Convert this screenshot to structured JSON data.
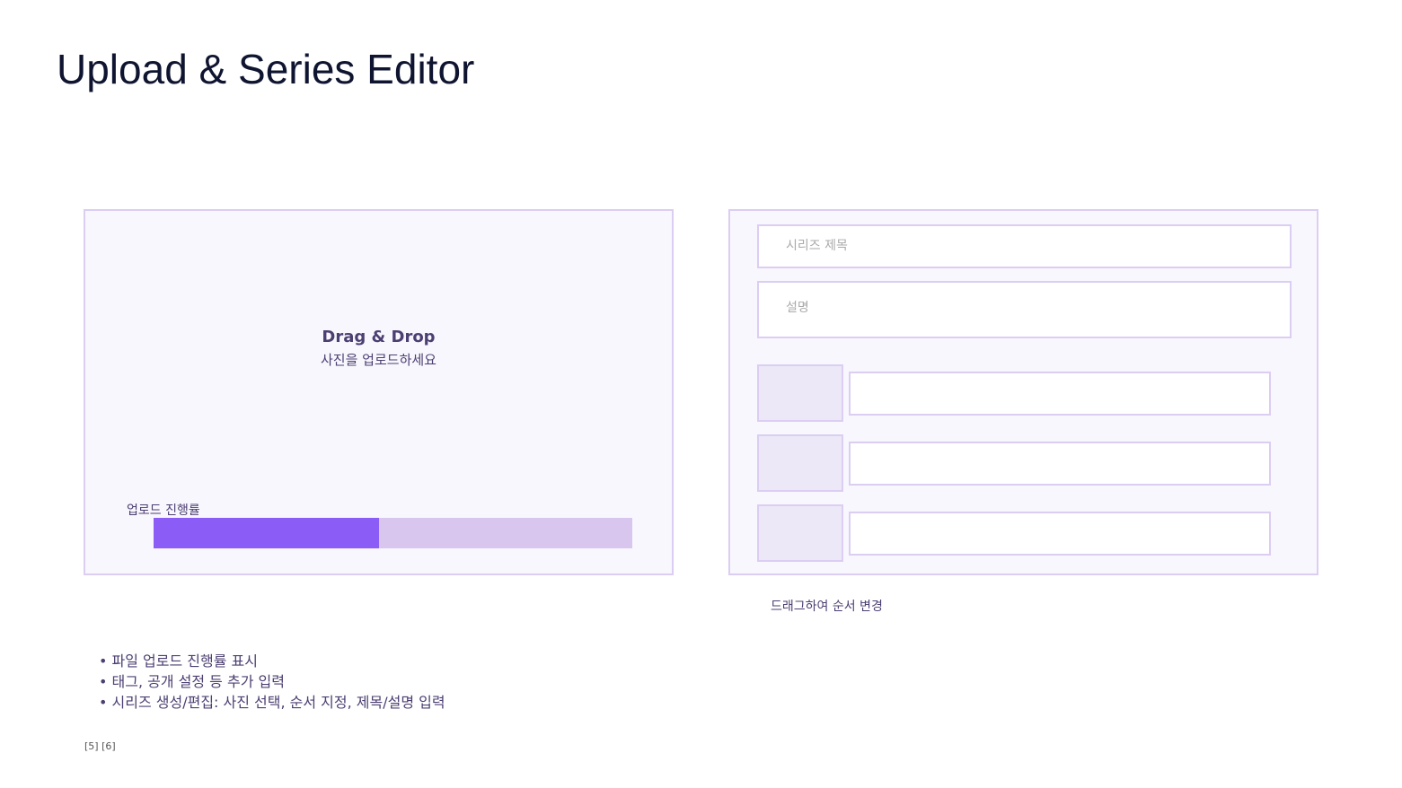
{
  "page_title": "Upload & Series Editor",
  "upload": {
    "title": "Drag & Drop",
    "subtitle": "사진을 업로드하세요",
    "progress_label": "업로드 진행률",
    "progress_percent": 47
  },
  "series": {
    "title_placeholder": "시리즈 제목",
    "description_placeholder": "설명",
    "items_count": 3,
    "reorder_hint": "드래그하여 순서 변경"
  },
  "bullets": [
    "• 파일 업로드 진행률 표시",
    "• 태그, 공개 설정 등 추가 입력",
    "• 시리즈 생성/편집: 사진 선택, 순서 지정, 제목/설명 입력"
  ],
  "footnote": "[5] [6]",
  "colors": {
    "accent": "#8b5cf6",
    "track": "#d8c6ef",
    "border": "#dccdf3"
  }
}
